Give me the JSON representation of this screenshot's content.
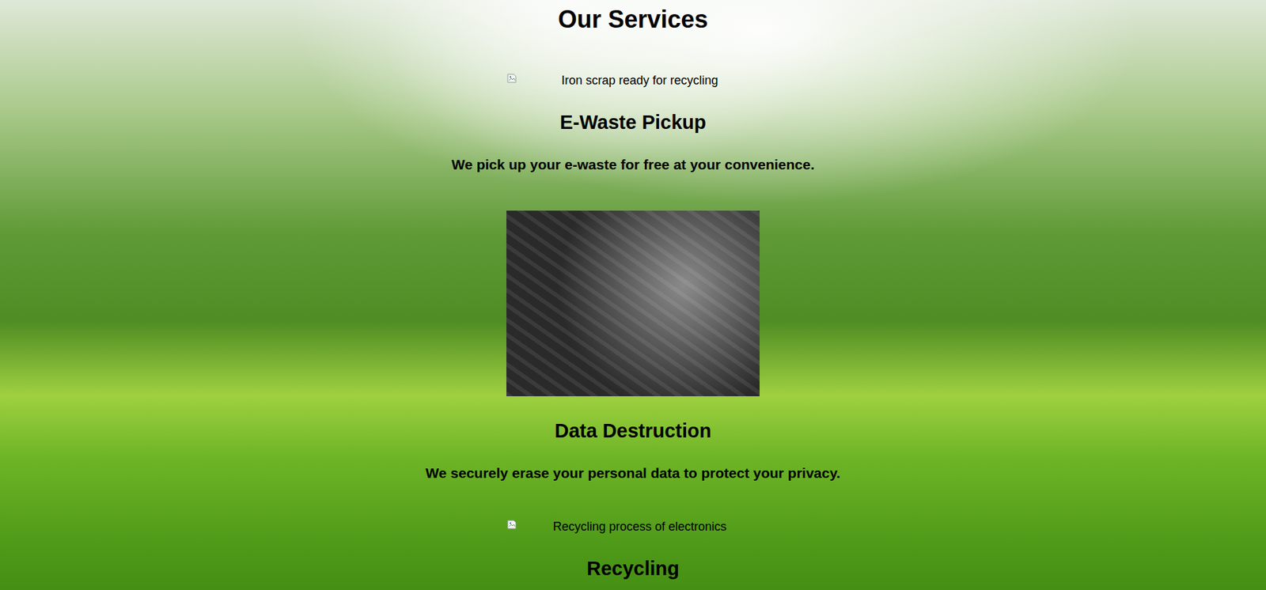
{
  "page": {
    "title": "Our Services"
  },
  "services": [
    {
      "name": "E-Waste Pickup",
      "description": "We pick up your e-waste for free at your convenience.",
      "image": {
        "kind": "broken",
        "alt": "Iron scrap ready for recycling"
      }
    },
    {
      "name": "Data Destruction",
      "description": "We securely erase your personal data to protect your privacy.",
      "image": {
        "kind": "photo",
        "alt": ""
      }
    },
    {
      "name": "Recycling",
      "image": {
        "kind": "broken",
        "alt": "Recycling process of electronics"
      }
    }
  ]
}
